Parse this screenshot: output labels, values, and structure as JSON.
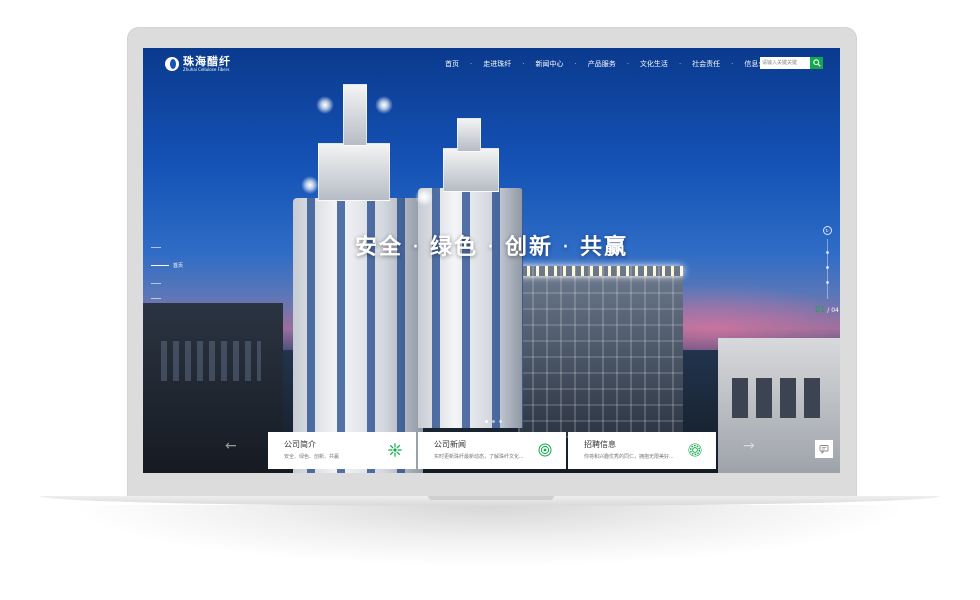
{
  "brand": {
    "name_cn": "珠海醋纤",
    "name_en": "Zhuhai Cellulose Fibers"
  },
  "nav": {
    "items": [
      "首页",
      "走进珠纤",
      "新闻中心",
      "产品服务",
      "文化生活",
      "社会责任",
      "信息公开"
    ],
    "separator": "·"
  },
  "search": {
    "placeholder": "请输入关键关键"
  },
  "hero": {
    "slogan_parts": [
      "安全",
      "绿色",
      "创新",
      "共赢"
    ],
    "slogan_dot": "·"
  },
  "side_nav": {
    "active_label": "首页"
  },
  "pager": {
    "current": "01",
    "total": "/ 04"
  },
  "cards": [
    {
      "title": "公司简介",
      "desc": "安全、绿色、创新、共赢",
      "icon": "sun-burst-icon"
    },
    {
      "title": "公司新闻",
      "desc": "实时更新珠纤最新动态，了解珠纤文化...",
      "icon": "target-icon"
    },
    {
      "title": "招聘信息",
      "desc": "你将和兴趣优秀的同仁，拥抱无限美好...",
      "icon": "gear-icon"
    }
  ],
  "colors": {
    "accent": "#13a84c",
    "sky_top": "#0a3a8e"
  }
}
